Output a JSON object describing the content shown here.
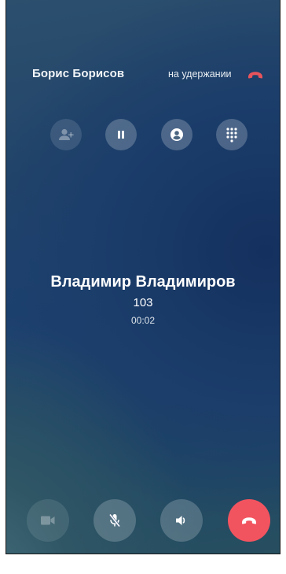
{
  "held_call": {
    "name": "Борис Борисов",
    "status": "на удержании",
    "hangup_icon": "phone-hangup-icon",
    "hangup_color": "#e8545c"
  },
  "top_actions": [
    {
      "id": "add-participant",
      "icon": "person-add-icon",
      "enabled": false
    },
    {
      "id": "hold",
      "icon": "pause-icon",
      "enabled": true
    },
    {
      "id": "contact",
      "icon": "account-circle-icon",
      "enabled": true
    },
    {
      "id": "dialpad",
      "icon": "dialpad-icon",
      "enabled": true
    }
  ],
  "active_call": {
    "name": "Владимир Владимиров",
    "number": "103",
    "duration": "00:02"
  },
  "bottom_actions": [
    {
      "id": "video",
      "icon": "video-camera-icon",
      "enabled": false
    },
    {
      "id": "mute",
      "icon": "microphone-off-icon",
      "enabled": true
    },
    {
      "id": "speaker",
      "icon": "speaker-icon",
      "enabled": true
    },
    {
      "id": "hangup",
      "icon": "phone-hangup-icon",
      "enabled": true
    }
  ],
  "colors": {
    "hangup_button": "#f2545f",
    "background_top": "#2c4f6e",
    "background_bottom": "#274f60"
  }
}
